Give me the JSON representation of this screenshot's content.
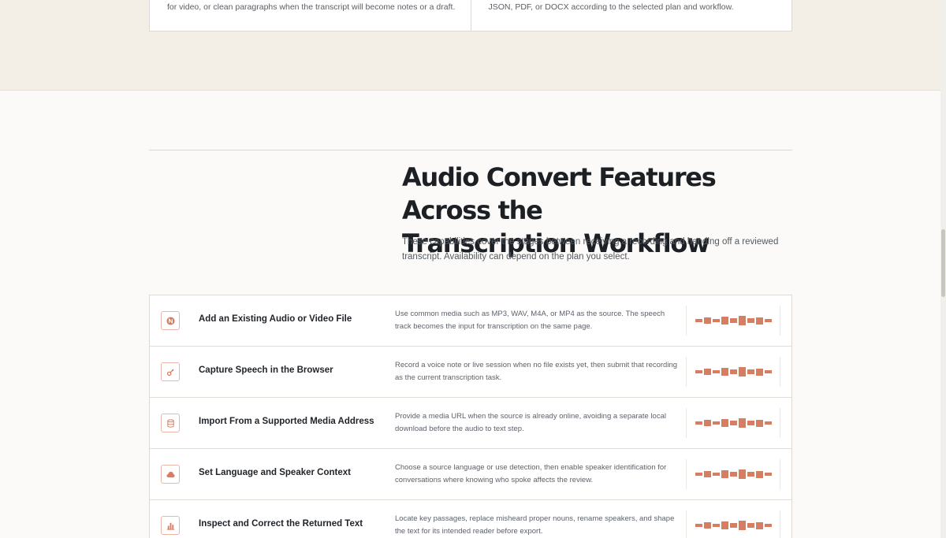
{
  "top_cards": {
    "left_text": "for video, or clean paragraphs when the transcript will become notes or a draft.",
    "right_text": "JSON, PDF, or DOCX according to the selected plan and workflow."
  },
  "section": {
    "title_line1": "Audio Convert Features Across the",
    "title_line2": "Transcription Workflow",
    "subtitle": "These capabilities cover the stages between receiving a recording and handing off a reviewed transcript. Availability can depend on the plan you select."
  },
  "colors": {
    "accent": "#d77d62",
    "icon_border": "#e9b7a8",
    "band": "#f3efe6"
  },
  "features": [
    {
      "icon": "upload-icon",
      "title": "Add an Existing Audio or Video File",
      "description": "Use common media such as MP3, WAV, M4A, or MP4 as the source. The speech track becomes the input for transcription on the same page."
    },
    {
      "icon": "microphone-icon",
      "title": "Capture Speech in the Browser",
      "description": "Record a voice note or live session when no file exists yet, then submit that recording as the current transcription task."
    },
    {
      "icon": "database-icon",
      "title": "Import From a Supported Media Address",
      "description": "Provide a media URL when the source is already online, avoiding a separate local download before the audio to text step."
    },
    {
      "icon": "cloud-icon",
      "title": "Set Language and Speaker Context",
      "description": "Choose a source language or use detection, then enable speaker identification for conversations where knowing who spoke affects the review."
    },
    {
      "icon": "chart-icon",
      "title": "Inspect and Correct the Returned Text",
      "description": "Locate key passages, replace misheard proper nouns, rename speakers, and shape the text for its intended reader before export."
    }
  ]
}
